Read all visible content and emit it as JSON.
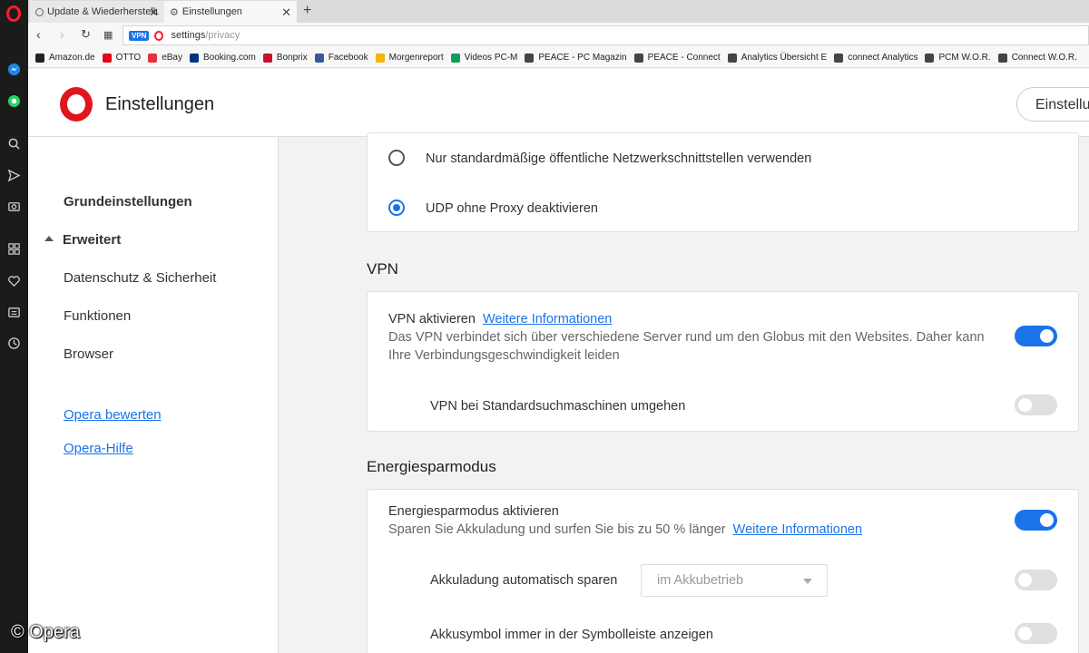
{
  "tabs": [
    {
      "label": "Update & Wiederherstellu",
      "active": false
    },
    {
      "label": "Einstellungen",
      "active": true
    }
  ],
  "address": {
    "vpn_badge": "VPN",
    "url_main": "settings",
    "url_sub": "/privacy"
  },
  "bookmarks": [
    {
      "label": "Amazon.de",
      "icon": "amazon-icon",
      "color": "#222"
    },
    {
      "label": "OTTO",
      "icon": "otto-icon",
      "color": "#e30613"
    },
    {
      "label": "eBay",
      "icon": "ebay-icon",
      "color": "#e53238"
    },
    {
      "label": "Booking.com",
      "icon": "booking-icon",
      "color": "#003580"
    },
    {
      "label": "Bonprix",
      "icon": "bonprix-icon",
      "color": "#c8102e"
    },
    {
      "label": "Facebook",
      "icon": "facebook-icon",
      "color": "#3b5998"
    },
    {
      "label": "Morgenreport",
      "icon": "drive-icon",
      "color": "#f4b400"
    },
    {
      "label": "Videos PC-M",
      "icon": "drive-icon",
      "color": "#0f9d58"
    },
    {
      "label": "PEACE - PC Magazin",
      "icon": "page-icon",
      "color": "#444"
    },
    {
      "label": "PEACE - Connect",
      "icon": "page-icon",
      "color": "#444"
    },
    {
      "label": "Analytics Übersicht E",
      "icon": "page-icon",
      "color": "#444"
    },
    {
      "label": "connect Analytics",
      "icon": "page-icon",
      "color": "#444"
    },
    {
      "label": "PCM W.O.R.",
      "icon": "page-icon",
      "color": "#444"
    },
    {
      "label": "Connect W.O.R.",
      "icon": "page-icon",
      "color": "#444"
    }
  ],
  "header": {
    "title": "Einstellungen",
    "search_label": "Einstellungen"
  },
  "nav": {
    "basic": "Grundeinstellungen",
    "advanced": "Erweitert",
    "privacy": "Datenschutz & Sicherheit",
    "features": "Funktionen",
    "browser": "Browser",
    "rate": "Opera bewerten",
    "help": "Opera-Hilfe"
  },
  "webrtc": {
    "option_public": "Nur standardmäßige öffentliche Netzwerkschnittstellen verwenden",
    "option_udp": "UDP ohne Proxy deaktivieren",
    "selected": "option_udp"
  },
  "vpn": {
    "title": "VPN",
    "enable_label": "VPN aktivieren",
    "more_info": "Weitere Informationen",
    "description": "Das VPN verbindet sich über verschiedene Server rund um den Globus mit den Websites. Daher kann Ihre Verbindungsgeschwindigkeit leiden",
    "enabled": true,
    "bypass_label": "VPN bei Standardsuchmaschinen umgehen",
    "bypass_enabled": false
  },
  "battery": {
    "title": "Energiesparmodus",
    "enable_label": "Energiesparmodus aktivieren",
    "description": "Sparen Sie Akkuladung und surfen Sie bis zu 50 % länger",
    "more_info": "Weitere Informationen",
    "enabled": true,
    "auto_label": "Akkuladung automatisch sparen",
    "auto_select": "im Akkubetrieb",
    "auto_enabled": false,
    "icon_label": "Akkusymbol immer in der Symbolleiste anzeigen",
    "icon_enabled": false
  },
  "watermark": "© Opera"
}
